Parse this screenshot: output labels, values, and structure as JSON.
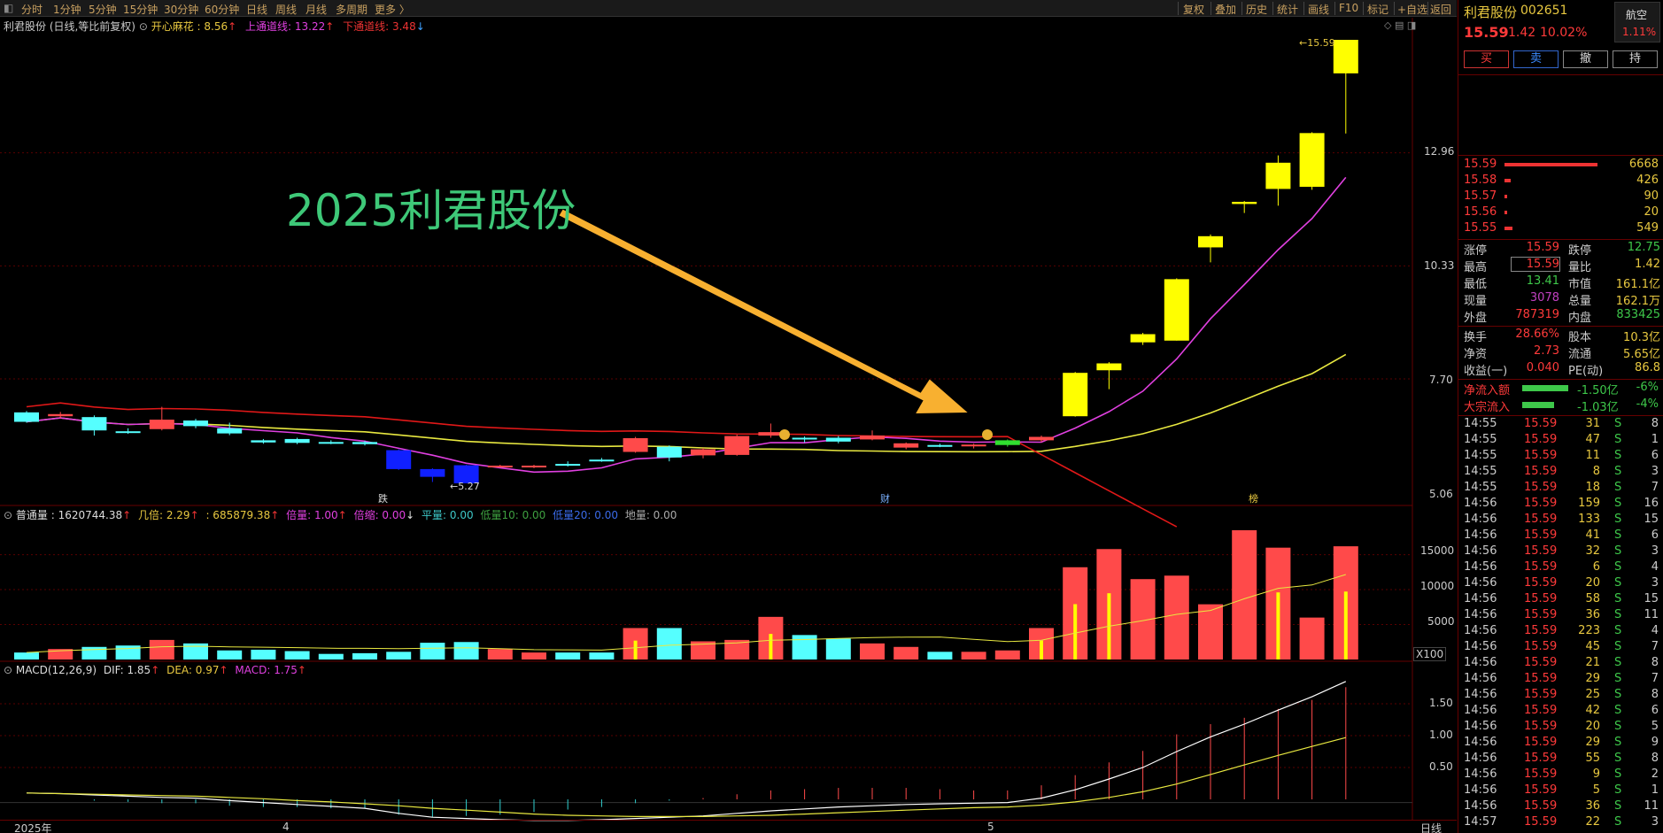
{
  "topbar": {
    "periods": [
      "分时",
      "1分钟",
      "5分钟",
      "15分钟",
      "30分钟",
      "60分钟",
      "日线",
      "周线",
      "月线",
      "多周期",
      "更多 〉"
    ],
    "tools": [
      "复权",
      "叠加",
      "历史",
      "统计",
      "画线",
      "F10",
      "标记",
      "+自选",
      "返回"
    ]
  },
  "main_legend": {
    "title": "利君股份 (日线,等比前复权)",
    "ind1": "开心麻花 : 8.56",
    "ind2": "上通道线: 13.22",
    "ind3": "下通道线: 3.48"
  },
  "annotation": "2025利君股份",
  "price_axis": [
    "12.96",
    "10.33",
    "7.70",
    "5.06"
  ],
  "high_label": "15.59",
  "low_label": "5.27",
  "markers": {
    "die": "跌",
    "cai": "财",
    "bang": "榜"
  },
  "vol_legend": {
    "v1": "普通量 : 1620744.38",
    "v2": "几倍: 2.29",
    "v3": ": 685879.38",
    "v4": "倍量: 1.00",
    "v5": "倍缩: 0.00",
    "v6": "平量: 0.00",
    "v7": "低量10: 0.00",
    "v8": "低量20: 0.00",
    "v9": "地量: 0.00"
  },
  "vol_axis": [
    "15000",
    "10000",
    "5000"
  ],
  "vol_unit": "X100",
  "macd_legend": {
    "name": "MACD(12,26,9)",
    "dif": "DIF: 1.85",
    "dea": "DEA: 0.97",
    "macd": "MACD: 1.75"
  },
  "macd_axis": [
    "1.50",
    "1.00",
    "0.50"
  ],
  "date_axis": [
    "2025年",
    "4",
    "5"
  ],
  "period_label": "日线",
  "stock": {
    "name": "利君股份",
    "code": "002651",
    "price": "15.59",
    "change": "1.42",
    "pct": "10.02%",
    "index_name": "航空",
    "index_pct": "1.11%"
  },
  "trade_buttons": [
    "买",
    "卖",
    "撤",
    "持"
  ],
  "asks": [
    {
      "price": "15.59",
      "vol": "6668"
    },
    {
      "price": "15.58",
      "vol": "426"
    },
    {
      "price": "15.57",
      "vol": "90"
    },
    {
      "price": "15.56",
      "vol": "20"
    },
    {
      "price": "15.55",
      "vol": "549"
    }
  ],
  "stats": [
    [
      "涨停",
      "15.59",
      "跌停",
      "12.75"
    ],
    [
      "最高",
      "15.59",
      "量比",
      "1.42"
    ],
    [
      "最低",
      "13.41",
      "市值",
      "161.1亿"
    ],
    [
      "现量",
      "3078",
      "总量",
      "162.1万"
    ],
    [
      "外盘",
      "787319",
      "内盘",
      "833425"
    ]
  ],
  "stats2": [
    [
      "换手",
      "28.66%",
      "股本",
      "10.3亿"
    ],
    [
      "净资",
      "2.73",
      "流通",
      "5.65亿"
    ],
    [
      "收益(一)",
      "0.040",
      "PE(动)",
      "86.8"
    ]
  ],
  "flows": [
    {
      "label": "净流入额",
      "value": "-1.50亿",
      "pct": "-6%"
    },
    {
      "label": "大宗流入",
      "value": "-1.03亿",
      "pct": "-4%"
    }
  ],
  "trades": [
    [
      "14:55",
      "15.59",
      "31",
      "S",
      "8"
    ],
    [
      "14:55",
      "15.59",
      "47",
      "S",
      "1"
    ],
    [
      "14:55",
      "15.59",
      "11",
      "S",
      "6"
    ],
    [
      "14:55",
      "15.59",
      "8",
      "S",
      "3"
    ],
    [
      "14:55",
      "15.59",
      "18",
      "S",
      "7"
    ],
    [
      "14:56",
      "15.59",
      "159",
      "S",
      "16"
    ],
    [
      "14:56",
      "15.59",
      "133",
      "S",
      "15"
    ],
    [
      "14:56",
      "15.59",
      "41",
      "S",
      "6"
    ],
    [
      "14:56",
      "15.59",
      "32",
      "S",
      "3"
    ],
    [
      "14:56",
      "15.59",
      "6",
      "S",
      "4"
    ],
    [
      "14:56",
      "15.59",
      "20",
      "S",
      "3"
    ],
    [
      "14:56",
      "15.59",
      "58",
      "S",
      "15"
    ],
    [
      "14:56",
      "15.59",
      "36",
      "S",
      "11"
    ],
    [
      "14:56",
      "15.59",
      "223",
      "S",
      "4"
    ],
    [
      "14:56",
      "15.59",
      "45",
      "S",
      "7"
    ],
    [
      "14:56",
      "15.59",
      "21",
      "S",
      "8"
    ],
    [
      "14:56",
      "15.59",
      "29",
      "S",
      "7"
    ],
    [
      "14:56",
      "15.59",
      "25",
      "S",
      "8"
    ],
    [
      "14:56",
      "15.59",
      "42",
      "S",
      "6"
    ],
    [
      "14:56",
      "15.59",
      "20",
      "S",
      "5"
    ],
    [
      "14:56",
      "15.59",
      "29",
      "S",
      "9"
    ],
    [
      "14:56",
      "15.59",
      "55",
      "S",
      "8"
    ],
    [
      "14:56",
      "15.59",
      "9",
      "S",
      "2"
    ],
    [
      "14:56",
      "15.59",
      "5",
      "S",
      "1"
    ],
    [
      "14:56",
      "15.59",
      "36",
      "S",
      "11"
    ],
    [
      "14:57",
      "15.59",
      "22",
      "S",
      "3"
    ]
  ],
  "chart_data": {
    "type": "candlestick",
    "candles": [
      {
        "o": 6.92,
        "c": 6.7,
        "h": 6.95,
        "l": 6.68
      },
      {
        "o": 6.83,
        "c": 6.88,
        "h": 6.93,
        "l": 6.78
      },
      {
        "o": 6.81,
        "c": 6.5,
        "h": 6.85,
        "l": 6.38
      },
      {
        "o": 6.48,
        "c": 6.47,
        "h": 6.55,
        "l": 6.42
      },
      {
        "o": 6.53,
        "c": 6.75,
        "h": 7.05,
        "l": 6.5
      },
      {
        "o": 6.73,
        "c": 6.6,
        "h": 6.77,
        "l": 6.55
      },
      {
        "o": 6.55,
        "c": 6.43,
        "h": 6.68,
        "l": 6.39
      },
      {
        "o": 6.27,
        "c": 6.22,
        "h": 6.3,
        "l": 6.19
      },
      {
        "o": 6.3,
        "c": 6.21,
        "h": 6.33,
        "l": 6.18
      },
      {
        "o": 6.23,
        "c": 6.21,
        "h": 6.27,
        "l": 6.18
      },
      {
        "o": 6.23,
        "c": 6.18,
        "h": 6.26,
        "l": 6.15
      },
      {
        "o": 6.04,
        "c": 5.6,
        "h": 6.06,
        "l": 5.58
      },
      {
        "o": 5.6,
        "c": 5.42,
        "h": 5.62,
        "l": 5.3
      },
      {
        "o": 5.69,
        "c": 5.27,
        "h": 5.7,
        "l": 5.27
      },
      {
        "o": 5.67,
        "c": 5.68,
        "h": 5.7,
        "l": 5.64
      },
      {
        "o": 5.64,
        "c": 5.68,
        "h": 5.7,
        "l": 5.62
      },
      {
        "o": 5.72,
        "c": 5.7,
        "h": 5.78,
        "l": 5.66
      },
      {
        "o": 5.82,
        "c": 5.81,
        "h": 5.86,
        "l": 5.77
      },
      {
        "o": 6.0,
        "c": 6.32,
        "h": 6.35,
        "l": 5.98
      },
      {
        "o": 6.12,
        "c": 5.87,
        "h": 6.15,
        "l": 5.78
      },
      {
        "o": 5.92,
        "c": 6.06,
        "h": 6.09,
        "l": 5.85
      },
      {
        "o": 5.93,
        "c": 6.37,
        "h": 6.4,
        "l": 5.91
      },
      {
        "o": 6.38,
        "c": 6.46,
        "h": 6.66,
        "l": 6.33
      },
      {
        "o": 6.33,
        "c": 6.3,
        "h": 6.36,
        "l": 6.22
      },
      {
        "o": 6.33,
        "c": 6.24,
        "h": 6.37,
        "l": 6.2
      },
      {
        "o": 6.29,
        "c": 6.38,
        "h": 6.5,
        "l": 6.27
      },
      {
        "o": 6.1,
        "c": 6.2,
        "h": 6.22,
        "l": 6.06
      },
      {
        "o": 6.16,
        "c": 6.14,
        "h": 6.19,
        "l": 6.11
      },
      {
        "o": 6.13,
        "c": 6.17,
        "h": 6.19,
        "l": 6.08
      },
      {
        "o": 6.16,
        "c": 6.27,
        "h": 6.29,
        "l": 6.12
      },
      {
        "o": 6.27,
        "c": 6.35,
        "h": 6.38,
        "l": 6.23
      },
      {
        "o": 6.83,
        "c": 7.84,
        "h": 7.86,
        "l": 6.82
      },
      {
        "o": 7.9,
        "c": 8.06,
        "h": 8.09,
        "l": 7.46
      },
      {
        "o": 8.74,
        "c": 8.55,
        "h": 8.77,
        "l": 8.49
      },
      {
        "o": 8.59,
        "c": 10.02,
        "h": 10.04,
        "l": 8.59
      },
      {
        "o": 10.76,
        "c": 11.02,
        "h": 11.06,
        "l": 10.41
      },
      {
        "o": 11.77,
        "c": 11.82,
        "h": 11.84,
        "l": 11.56
      },
      {
        "o": 12.73,
        "c": 12.12,
        "h": 12.9,
        "l": 11.73
      },
      {
        "o": 13.42,
        "c": 12.17,
        "h": 13.44,
        "l": 12.1
      },
      {
        "o": 15.59,
        "c": 14.81,
        "h": 15.59,
        "l": 13.41
      }
    ],
    "volume": [
      1000,
      1500,
      1800,
      2000,
      2800,
      2300,
      1300,
      1400,
      1200,
      800,
      900,
      1100,
      2400,
      2500,
      1500,
      1000,
      1000,
      1000,
      4500,
      4500,
      2600,
      2800,
      6100,
      3500,
      3000,
      2300,
      1800,
      1100,
      1100,
      1300,
      4500,
      13200,
      15800,
      11500,
      12000,
      7900,
      18500,
      16000,
      6000,
      16200
    ],
    "macd_dif": [
      0.1,
      0.09,
      0.07,
      0.05,
      0.03,
      0.02,
      -0.02,
      -0.05,
      -0.08,
      -0.11,
      -0.14,
      -0.22,
      -0.28,
      -0.3,
      -0.32,
      -0.33,
      -0.33,
      -0.32,
      -0.3,
      -0.28,
      -0.26,
      -0.22,
      -0.18,
      -0.15,
      -0.12,
      -0.1,
      -0.08,
      -0.07,
      -0.06,
      -0.05,
      0.02,
      0.15,
      0.32,
      0.5,
      0.75,
      0.98,
      1.18,
      1.4,
      1.61,
      1.85
    ],
    "macd_dea": [
      0.1,
      0.09,
      0.08,
      0.07,
      0.06,
      0.05,
      0.03,
      0.01,
      -0.02,
      -0.04,
      -0.07,
      -0.1,
      -0.14,
      -0.17,
      -0.2,
      -0.23,
      -0.25,
      -0.26,
      -0.27,
      -0.27,
      -0.27,
      -0.26,
      -0.25,
      -0.23,
      -0.21,
      -0.19,
      -0.17,
      -0.15,
      -0.13,
      -0.12,
      -0.09,
      -0.04,
      0.03,
      0.12,
      0.24,
      0.39,
      0.54,
      0.69,
      0.83,
      0.97
    ],
    "y_axis": {
      "min": 5.06,
      "max": 15.59,
      "ticks": [
        12.96,
        10.33,
        7.7,
        5.06
      ]
    },
    "volume_axis": {
      "ticks": [
        15000,
        10000,
        5000
      ],
      "unit": "X100"
    },
    "macd_axis": {
      "ticks": [
        1.5,
        1.0,
        0.5
      ]
    }
  }
}
